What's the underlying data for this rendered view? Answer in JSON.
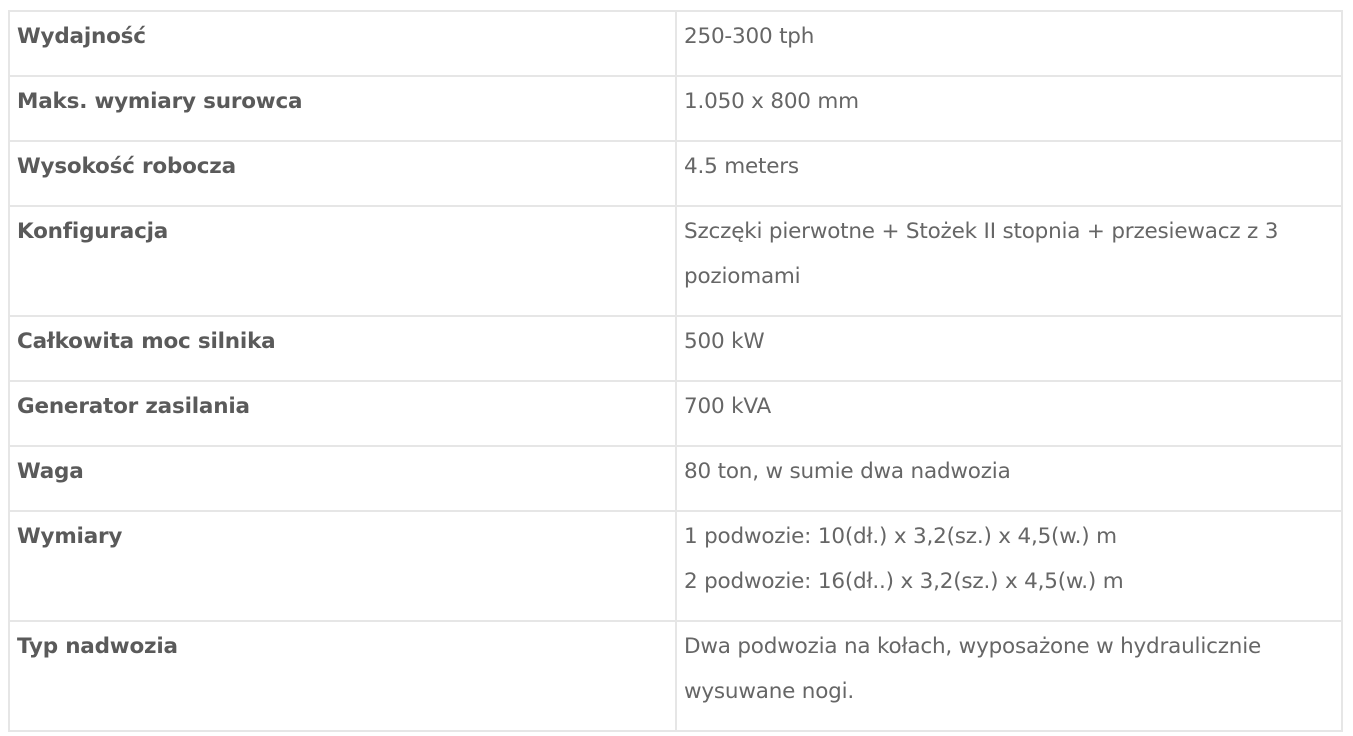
{
  "specs": [
    {
      "label": "Wydajność",
      "value": [
        "250-300 tph"
      ]
    },
    {
      "label": "Maks. wymiary surowca",
      "value": [
        "1.050 x 800 mm"
      ]
    },
    {
      "label": "Wysokość robocza",
      "value": [
        "4.5 meters"
      ]
    },
    {
      "label": "Konfiguracja",
      "value": [
        "Szczęki pierwotne + Stożek II stopnia + przesiewacz z 3 poziomami"
      ]
    },
    {
      "label": "Całkowita moc silnika",
      "value": [
        "500 kW"
      ]
    },
    {
      "label": "Generator zasilania",
      "value": [
        "700 kVA"
      ]
    },
    {
      "label": "Waga",
      "value": [
        "80 ton, w sumie dwa nadwozia"
      ]
    },
    {
      "label": "Wymiary",
      "value": [
        "1 podwozie: 10(dł.) x 3,2(sz.) x 4,5(w.) m",
        "2 podwozie: 16(dł..) x 3,2(sz.) x 4,5(w.) m"
      ]
    },
    {
      "label": "Typ nadwozia",
      "value": [
        "Dwa podwozia na kołach, wyposażone w hydraulicznie wysuwane nogi."
      ]
    }
  ]
}
